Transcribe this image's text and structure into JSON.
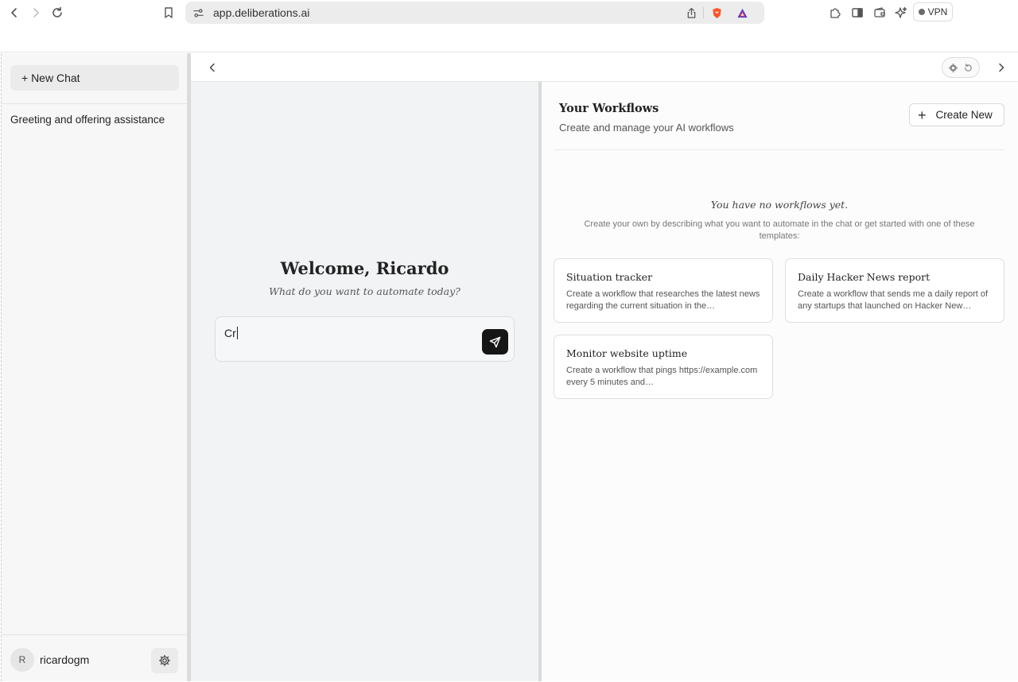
{
  "browser": {
    "url": "app.deliberations.ai",
    "vpn_label": "VPN",
    "icons": [
      "back-icon",
      "forward-icon",
      "reload-icon",
      "bookmark-icon",
      "site-settings-icon",
      "share-icon",
      "brave-shield-icon",
      "brave-rewards-icon",
      "extensions-icon",
      "sidebar-icon",
      "wallet-icon",
      "leo-ai-icon"
    ]
  },
  "sidebar": {
    "new_chat_label": "+ New Chat",
    "chats": [
      "Greeting and offering assistance"
    ],
    "user": {
      "avatar_initial": "R",
      "username": "ricardogm"
    }
  },
  "chat": {
    "welcome_title": "Welcome, Ricardo",
    "welcome_subtitle": "What do you want to automate today?",
    "input_value": "Cr"
  },
  "workflows": {
    "title": "Your Workflows",
    "subtitle": "Create and manage your AI workflows",
    "create_button_label": "Create New",
    "empty_title": "You have no workflows yet.",
    "empty_subtitle": "Create your own by describing what you want to automate in the chat or get started with one of these templates:",
    "templates": [
      {
        "title": "Situation tracker",
        "description": "Create a workflow that researches the latest news regarding the current situation in the…"
      },
      {
        "title": "Daily Hacker News report",
        "description": "Create a workflow that sends me a daily report of any startups that launched on Hacker New…"
      },
      {
        "title": "Monitor website uptime",
        "description": "Create a workflow that pings https://example.com every 5 minutes and…"
      }
    ]
  },
  "colors": {
    "send_button": "#161616",
    "chat_panel_bg": "#f2f3f5",
    "sidebar_bg": "#f7f7f7"
  }
}
